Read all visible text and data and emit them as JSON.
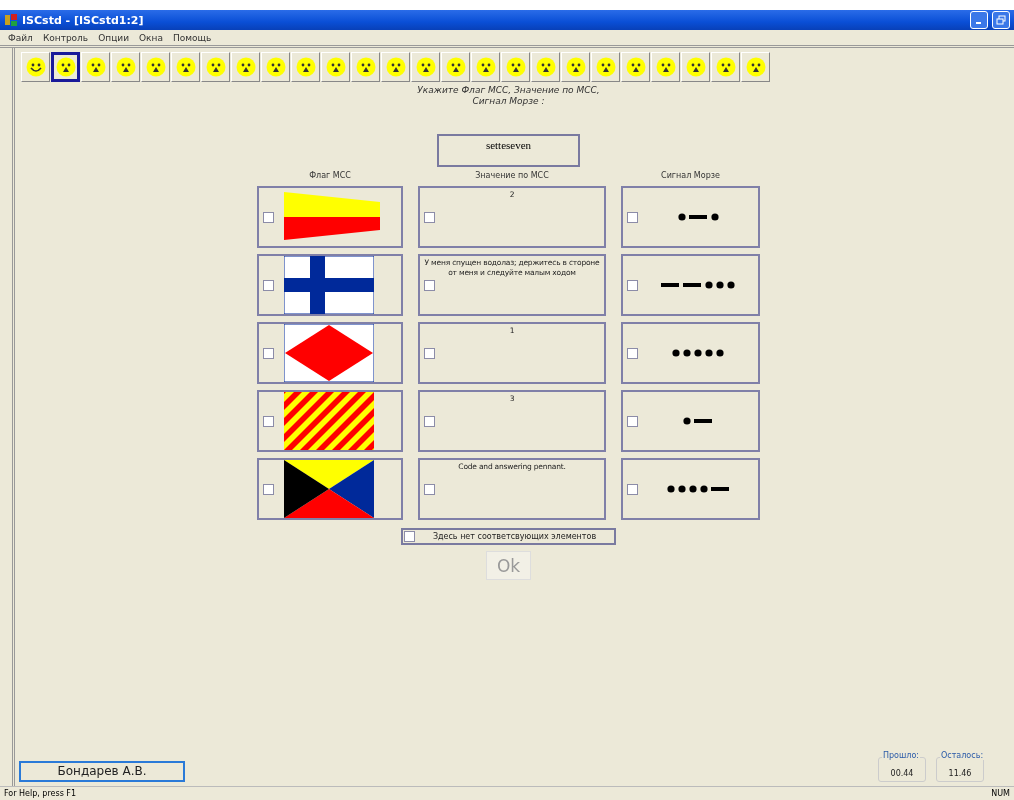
{
  "window": {
    "title": "ISCstd - [ISCstd1:2]"
  },
  "menu": [
    "Файл",
    "Контроль",
    "Опции",
    "Окна",
    "Помощь"
  ],
  "toolbar": [
    {
      "smiling": true,
      "selected": false
    },
    {
      "smiling": false,
      "selected": true
    },
    {
      "smiling": false,
      "selected": false
    },
    {
      "smiling": false,
      "selected": false
    },
    {
      "smiling": false,
      "selected": false
    },
    {
      "smiling": false,
      "selected": false
    },
    {
      "smiling": false,
      "selected": false
    },
    {
      "smiling": false,
      "selected": false
    },
    {
      "smiling": false,
      "selected": false
    },
    {
      "smiling": false,
      "selected": false
    },
    {
      "smiling": false,
      "selected": false
    },
    {
      "smiling": false,
      "selected": false
    },
    {
      "smiling": false,
      "selected": false
    },
    {
      "smiling": false,
      "selected": false
    },
    {
      "smiling": false,
      "selected": false
    },
    {
      "smiling": false,
      "selected": false
    },
    {
      "smiling": false,
      "selected": false
    },
    {
      "smiling": false,
      "selected": false
    },
    {
      "smiling": false,
      "selected": false
    },
    {
      "smiling": false,
      "selected": false
    },
    {
      "smiling": false,
      "selected": false
    },
    {
      "smiling": false,
      "selected": false
    },
    {
      "smiling": false,
      "selected": false
    },
    {
      "smiling": false,
      "selected": false
    },
    {
      "smiling": false,
      "selected": false
    }
  ],
  "instruction": [
    "Укажите Флаг МСС, Значение по МСС,",
    "Сигнал Морзе :"
  ],
  "word": "setteseven",
  "columns": [
    "Флаг МСС",
    "Значение по МСС",
    "Сигнал Морзе"
  ],
  "rows": [
    {
      "flag": {
        "kind": "pennant",
        "checked": false
      },
      "meaning": {
        "text": "2",
        "checked": false
      },
      "morse": {
        "symbols": [
          {
            "kind": "dot"
          },
          {
            "kind": "dash"
          },
          {
            "kind": "dot"
          }
        ],
        "checked": false
      }
    },
    {
      "flag": {
        "kind": "cross",
        "checked": false
      },
      "meaning": {
        "text": "У меня спущен водолаз; держитесь в стороне от меня и следуйте малым ходом",
        "checked": false
      },
      "morse": {
        "symbols": [
          {
            "kind": "dash"
          },
          {
            "kind": "dash"
          },
          {
            "kind": "dot"
          },
          {
            "kind": "dot"
          },
          {
            "kind": "dot"
          }
        ],
        "checked": false
      }
    },
    {
      "flag": {
        "kind": "diamond",
        "checked": false
      },
      "meaning": {
        "text": "1",
        "checked": false
      },
      "morse": {
        "symbols": [
          {
            "kind": "dot"
          },
          {
            "kind": "dot"
          },
          {
            "kind": "dot"
          },
          {
            "kind": "dot"
          },
          {
            "kind": "dot"
          }
        ],
        "checked": false
      }
    },
    {
      "flag": {
        "kind": "stripes",
        "checked": false
      },
      "meaning": {
        "text": "3",
        "checked": false
      },
      "morse": {
        "symbols": [
          {
            "kind": "dot"
          },
          {
            "kind": "dash"
          }
        ],
        "checked": false
      }
    },
    {
      "flag": {
        "kind": "triangles",
        "checked": false
      },
      "meaning": {
        "text": "Code and answering pennant.",
        "checked": false
      },
      "morse": {
        "symbols": [
          {
            "kind": "dot"
          },
          {
            "kind": "dot"
          },
          {
            "kind": "dot"
          },
          {
            "kind": "dot"
          },
          {
            "kind": "dash"
          }
        ],
        "checked": false
      }
    }
  ],
  "none_option": {
    "label": "Здесь нет соответсвующих элементов",
    "checked": false
  },
  "ok_button": {
    "label": "Ok",
    "disabled": true
  },
  "student": "Бондарев А.В.",
  "timers": [
    {
      "label": "Прошло:",
      "value": "00.44"
    },
    {
      "label": "Осталось:",
      "value": "11.46"
    }
  ],
  "status_bar": {
    "help": "For Help, press F1",
    "indicator": "NUM"
  }
}
